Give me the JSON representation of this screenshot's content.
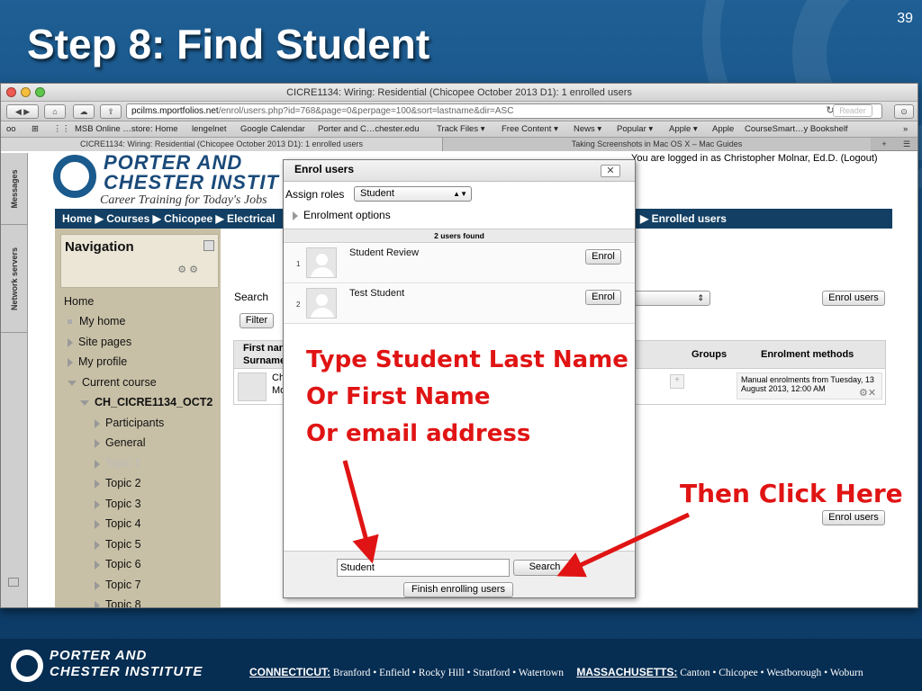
{
  "slide": {
    "title": "Step 8: Find Student",
    "number": "39"
  },
  "browser": {
    "window_title": "CICRE1134: Wiring: Residential (Chicopee October 2013 D1): 1 enrolled users",
    "url_host": "pcilms.mportfolios.net",
    "url_path": "/enrol/users.php?id=768&page=0&perpage=100&sort=lastname&dir=ASC",
    "reader_label": "Reader",
    "bookmarks": [
      "MSB Online …store: Home",
      "lengelnet",
      "Google Calendar",
      "Porter and C…chester.edu",
      "Track Files ▾",
      "Free Content ▾",
      "News ▾",
      "Popular ▾",
      "Apple ▾",
      "Apple",
      "CourseSmart…y Bookshelf"
    ],
    "tabs": [
      "CICRE1134: Wiring: Residential (Chicopee October 2013 D1): 1 enrolled users",
      "Taking Screenshots in Mac OS X – Mac Guides"
    ]
  },
  "sidebar_tabs": [
    "Messages",
    "Network servers"
  ],
  "site": {
    "logo_line1": "PORTER AND",
    "logo_line2": "CHESTER INSTIT",
    "logo_tagline": "Career Training for Today's Jobs",
    "logged_in": "You are logged in as Christopher Molnar, Ed.D. (Logout)",
    "breadcrumb": "Home ▶ Courses ▶ Chicopee ▶ Electrical",
    "breadcrumb_end": "▶ Enrolled users"
  },
  "navigation": {
    "title": "Navigation",
    "items": [
      {
        "label": "Home",
        "type": "plain"
      },
      {
        "label": "My home",
        "type": "square"
      },
      {
        "label": "Site pages",
        "type": "collapsed"
      },
      {
        "label": "My profile",
        "type": "collapsed"
      },
      {
        "label": "Current course",
        "type": "expanded"
      },
      {
        "label": "CH_CICRE1134_OCT2",
        "type": "expanded"
      },
      {
        "label": "Participants",
        "type": "collapsed"
      },
      {
        "label": "General",
        "type": "collapsed"
      },
      {
        "label": "Topic 1",
        "type": "collapsed"
      },
      {
        "label": "Topic 2",
        "type": "collapsed"
      },
      {
        "label": "Topic 3",
        "type": "collapsed"
      },
      {
        "label": "Topic 4",
        "type": "collapsed"
      },
      {
        "label": "Topic 5",
        "type": "collapsed"
      },
      {
        "label": "Topic 6",
        "type": "collapsed"
      },
      {
        "label": "Topic 7",
        "type": "collapsed"
      },
      {
        "label": "Topic 8",
        "type": "collapsed"
      }
    ]
  },
  "main": {
    "search_label": "Search",
    "filter_label": "Filter",
    "enrol_users_label": "Enrol users",
    "col_first": "First nar",
    "col_surname": "Surname",
    "col_groups": "Groups",
    "col_methods": "Enrolment methods",
    "row_name_1": "Ch",
    "row_name_2": "Mo",
    "row_method": "Manual enrolments from Tuesday, 13 August 2013, 12:00 AM"
  },
  "dialog": {
    "title": "Enrol users",
    "close_label": "✕",
    "assign_roles_label": "Assign roles",
    "role_value": "Student",
    "enrolment_options": "Enrolment options",
    "found_text": "2 users found",
    "users": [
      {
        "index": "1",
        "name": "Student Review",
        "button": "Enrol"
      },
      {
        "index": "2",
        "name": "Test Student",
        "button": "Enrol"
      }
    ],
    "search_value": "Student",
    "search_button": "Search",
    "finish_button": "Finish enrolling users"
  },
  "annotations": {
    "line1": "Type Student Last Name",
    "line2": "Or First Name",
    "line3": "Or email address",
    "click_here": "Then Click Here"
  },
  "footer": {
    "logo_line1": "PORTER AND",
    "logo_line2": "CHESTER INSTITUTE",
    "ct_label": "CONNECTICUT:",
    "ct_towns": "Branford • Enfield • Rocky Hill • Stratford • Watertown",
    "ma_label": "MASSACHUSETTS:",
    "ma_towns": "Canton • Chicopee • Westborough • Woburn"
  },
  "colors": {
    "annotation_red": "#e01414",
    "slide_blue": "#114a7d",
    "crumb_blue": "#123f63"
  }
}
